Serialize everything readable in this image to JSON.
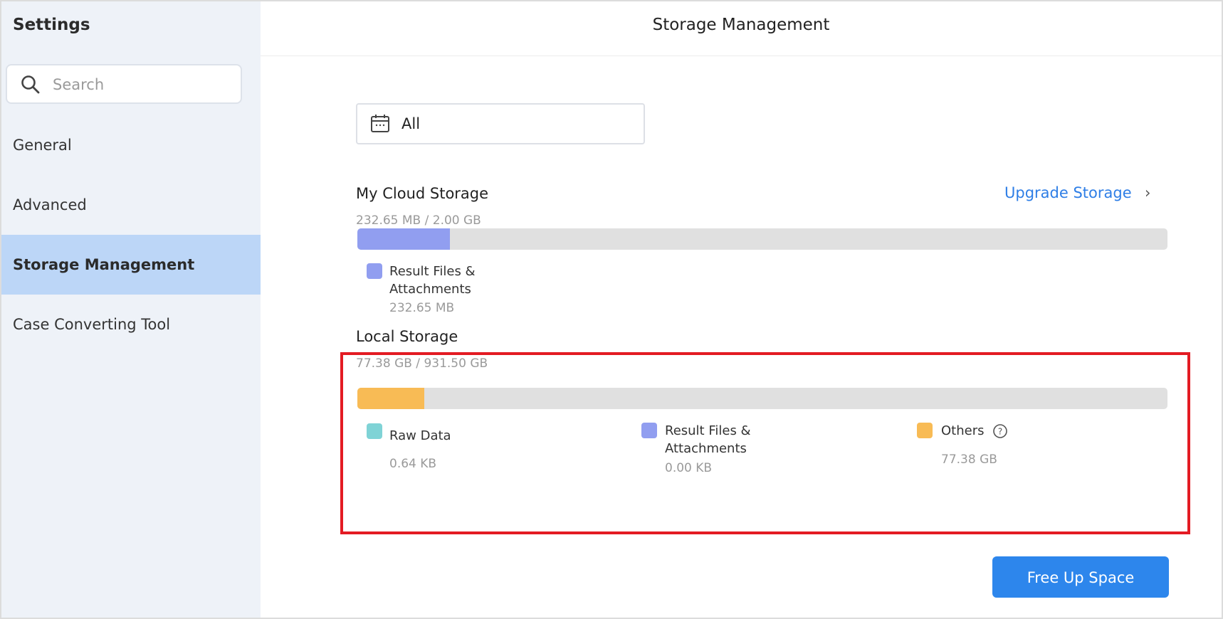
{
  "sidebar": {
    "title": "Settings",
    "search_placeholder": "Search",
    "items": [
      {
        "label": "General"
      },
      {
        "label": "Advanced"
      },
      {
        "label": "Storage Management"
      },
      {
        "label": "Case Converting Tool"
      }
    ],
    "active_index": 2
  },
  "header": {
    "title": "Storage Management"
  },
  "filter": {
    "value": "All"
  },
  "cloud": {
    "title": "My Cloud Storage",
    "usage": "232.65 MB / 2.00 GB",
    "upgrade_label": "Upgrade Storage",
    "fill_fraction": 0.114,
    "legend": [
      {
        "label_line1": "Result Files &",
        "label_line2": "Attachments",
        "value": "232.65 MB",
        "color": "#919ef0"
      }
    ]
  },
  "local": {
    "title": "Local Storage",
    "usage": "77.38 GB / 931.50 GB",
    "fill_fraction": 0.083,
    "legend": [
      {
        "label": "Raw Data",
        "value": "0.64 KB",
        "color": "#7fd3d6"
      },
      {
        "label_line1": "Result Files &",
        "label_line2": "Attachments",
        "value": "0.00 KB",
        "color": "#919ef0"
      },
      {
        "label": "Others",
        "value": "77.38 GB",
        "color": "#f8bb55"
      }
    ]
  },
  "actions": {
    "free_up_label": "Free Up Space"
  },
  "colors": {
    "accent": "#2d86ec",
    "cloud_fill": "#919ef0",
    "local_fill": "#f8bb55",
    "highlight": "#e31b23"
  }
}
